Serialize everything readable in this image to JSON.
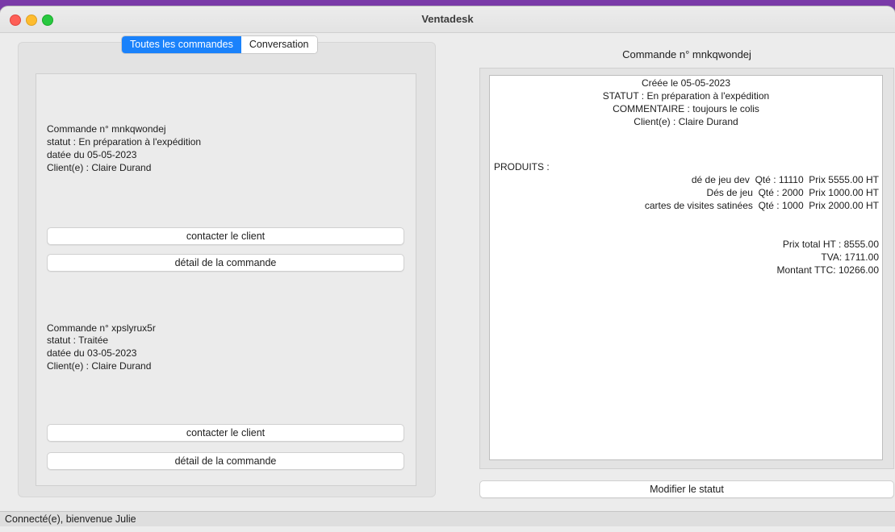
{
  "window": {
    "title": "Ventadesk"
  },
  "tabs": [
    {
      "label": "Toutes les commandes"
    },
    {
      "label": "Conversation"
    }
  ],
  "orders": [
    {
      "line1": "Commande n° mnkqwondej",
      "line2": "statut : En préparation à l'expédition",
      "line3": "datée du 05-05-2023",
      "line4": "Client(e) : Claire Durand",
      "contact_label": "contacter le client",
      "detail_label": "détail de la commande"
    },
    {
      "line1": "Commande n° xpslyrux5r",
      "line2": "statut : Traitée",
      "line3": "datée du 03-05-2023",
      "line4": "Client(e) : Claire Durand",
      "contact_label": "contacter le client",
      "detail_label": "détail de la commande"
    }
  ],
  "detail": {
    "title": "Commande n° mnkqwondej",
    "created": "Créée le 05-05-2023",
    "status": "STATUT : En préparation à l'expédition",
    "comment": "COMMENTAIRE : toujours le colis",
    "client": "Client(e) : Claire Durand",
    "products_header": "PRODUITS :",
    "products": [
      "dé de jeu dev  Qté : 11110  Prix 5555.00 HT",
      "Dés de jeu  Qté : 2000  Prix 1000.00 HT",
      "cartes de visites satinées  Qté : 1000  Prix 2000.00 HT"
    ],
    "total_ht": "Prix total HT : 8555.00",
    "tva": "TVA: 1711.00",
    "total_ttc": "Montant TTC: 10266.00",
    "modify_label": "Modifier le statut"
  },
  "status_bar": {
    "text": "Connecté(e), bienvenue Julie"
  }
}
